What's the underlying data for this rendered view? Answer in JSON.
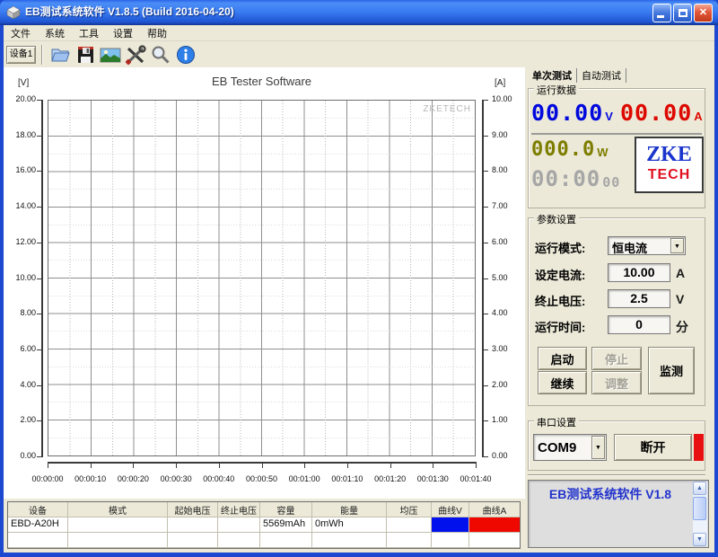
{
  "window": {
    "title": "EB测试系统软件 V1.8.5 (Build 2016-04-20)"
  },
  "menu": {
    "items": [
      "文件",
      "系统",
      "工具",
      "设置",
      "帮助"
    ]
  },
  "toolbar": {
    "device_button": "设备1"
  },
  "chart_data": {
    "type": "line",
    "title": "EB Tester Software",
    "watermark": "ZKETECH",
    "series": [],
    "grid": {
      "x_divisions": 10,
      "y_divisions": 10,
      "minor_lines": true
    },
    "left_axis": {
      "label": "[V]",
      "min": 0,
      "max": 20,
      "ticks": [
        "20.00",
        "18.00",
        "16.00",
        "14.00",
        "12.00",
        "10.00",
        "8.00",
        "6.00",
        "4.00",
        "2.00",
        "0.00"
      ]
    },
    "right_axis": {
      "label": "[A]",
      "min": 0,
      "max": 10,
      "ticks": [
        "10.00",
        "9.00",
        "8.00",
        "7.00",
        "6.00",
        "5.00",
        "4.00",
        "3.00",
        "2.00",
        "1.00",
        "0.00"
      ]
    },
    "x_axis": {
      "ticks": [
        "00:00:00",
        "00:00:10",
        "00:00:20",
        "00:00:30",
        "00:00:40",
        "00:00:50",
        "00:01:00",
        "00:01:10",
        "00:01:20",
        "00:01:30",
        "00:01:40"
      ]
    }
  },
  "right_panel": {
    "tabs": [
      {
        "label": "单次测试",
        "active": true
      },
      {
        "label": "自动测试",
        "active": false
      }
    ],
    "run_data": {
      "group_label": "运行数据",
      "voltage": {
        "value": "00.00",
        "unit": "V",
        "color": "#0008dd"
      },
      "current": {
        "value": "00.00",
        "unit": "A",
        "color": "#dd0800"
      },
      "power": {
        "value": "000.0",
        "unit": "W",
        "color": "#7d7d00"
      },
      "elapsed": {
        "value": "00:00",
        "seconds": "00",
        "color": "#a6a6a6"
      },
      "logo": {
        "line1": "ZKE",
        "line2": "TECH",
        "color1": "#1a35cc",
        "color2": "#e01020"
      }
    },
    "params": {
      "group_label": "参数设置",
      "mode": {
        "label": "运行模式:",
        "value": "恒电流"
      },
      "set_current": {
        "label": "设定电流:",
        "value": "10.00",
        "unit": "A"
      },
      "cutoff_voltage": {
        "label": "终止电压:",
        "value": "2.5",
        "unit": "V"
      },
      "run_time": {
        "label": "运行时间:",
        "value": "0",
        "unit": "分"
      },
      "buttons": {
        "start": "启动",
        "stop": "停止",
        "monitor": "监测",
        "resume": "继续",
        "adjust": "调整"
      }
    },
    "serial": {
      "group_label": "串口设置",
      "port": "COM9",
      "disconnect_button": "断开",
      "status_color": "#e81010"
    },
    "message_box": {
      "text": "EB测试系统软件 V1.8",
      "text_color": "#2233cc"
    }
  },
  "bottom_table": {
    "headers": [
      "设备",
      "模式",
      "起始电压",
      "终止电压",
      "容量",
      "能量",
      "均压",
      "曲线V",
      "曲线A"
    ],
    "rows": [
      {
        "device": "EBD-A20H",
        "mode": "",
        "start_v": "",
        "end_v": "",
        "capacity": "5569mAh",
        "energy": "0mWh",
        "avg_v": "",
        "curve_v_color": "#0011ee",
        "curve_a_color": "#ee0800"
      },
      {
        "device": "",
        "mode": "",
        "start_v": "",
        "end_v": "",
        "capacity": "",
        "energy": "",
        "avg_v": "",
        "curve_v_color": "",
        "curve_a_color": ""
      }
    ]
  }
}
